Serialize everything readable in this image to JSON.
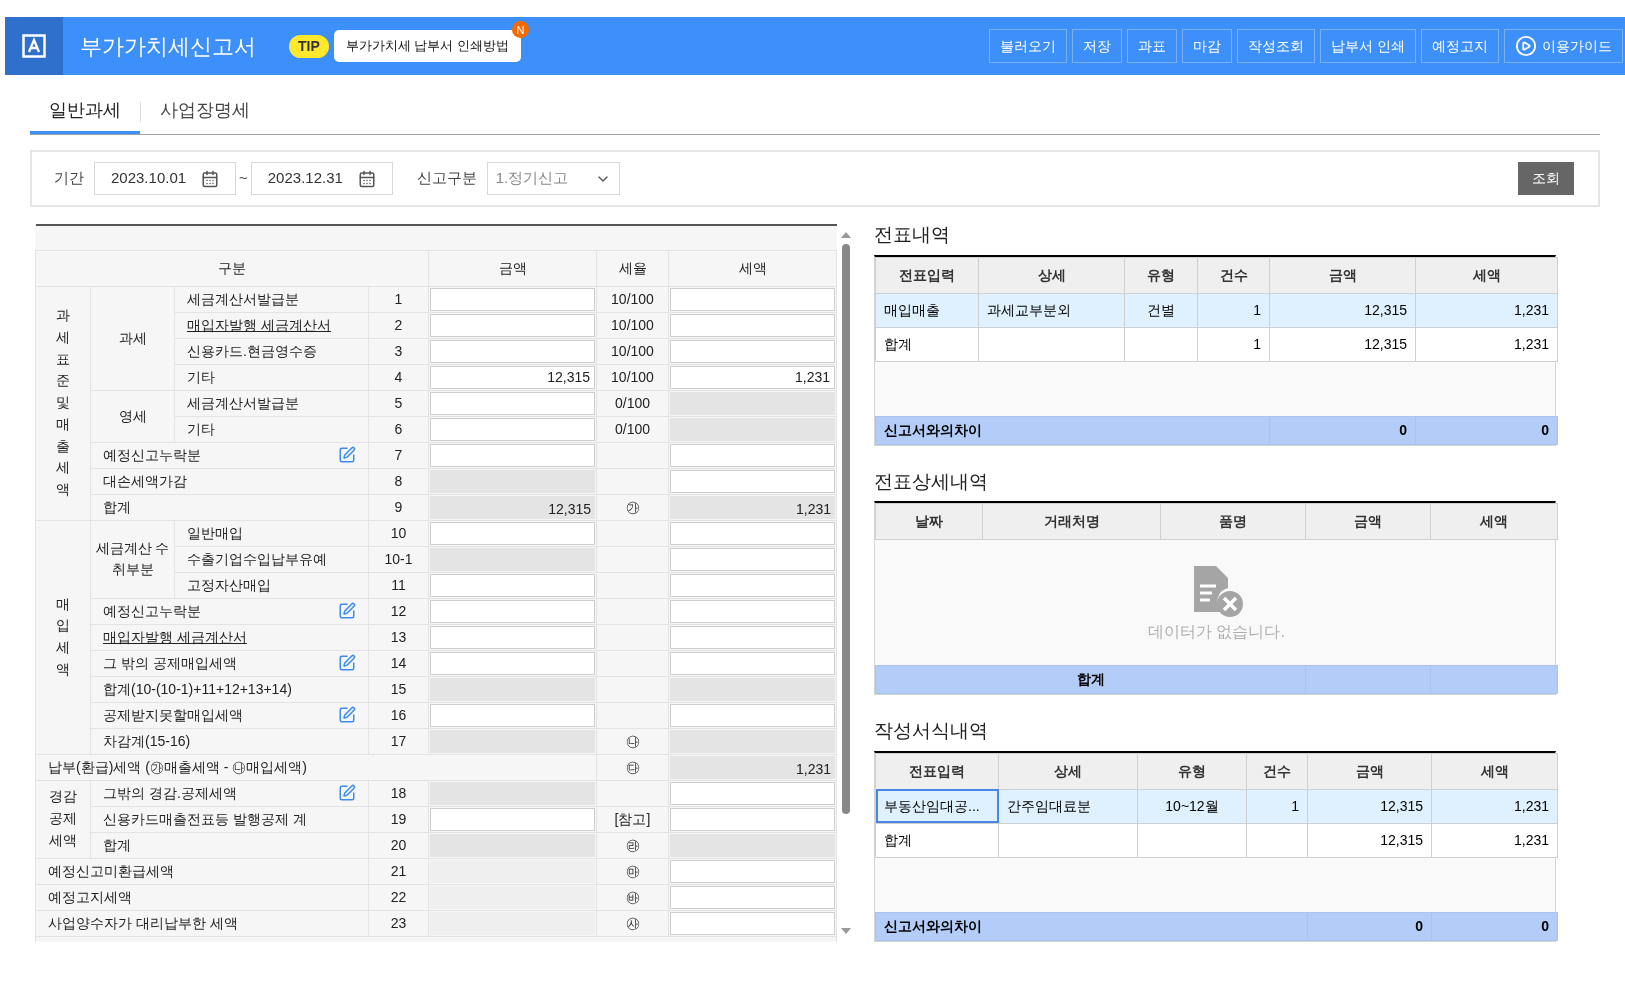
{
  "header": {
    "title": "부가가치세신고서",
    "tip_badge": "TIP",
    "tip_text": "부가가치세 납부서 인쇄방법",
    "tip_new": "N",
    "buttons": [
      {
        "label": "불러오기",
        "kind": "text"
      },
      {
        "label": "저장",
        "kind": "text"
      },
      {
        "label": "과표",
        "kind": "text"
      },
      {
        "label": "마감",
        "kind": "text"
      },
      {
        "label": "작성조회",
        "kind": "text"
      },
      {
        "label": "납부서 인쇄",
        "kind": "text"
      },
      {
        "label": "예정고지",
        "kind": "text"
      },
      {
        "label": "이용가이드",
        "kind": "guide"
      }
    ]
  },
  "tabs": [
    {
      "label": "일반과세",
      "selected": true
    },
    {
      "label": "사업장명세",
      "selected": false
    }
  ],
  "filter": {
    "period_label": "기간",
    "start": "2023.10.01",
    "separator": "~",
    "end": "2023.12.31",
    "type_label": "신고구분",
    "type_value": "1.정기신고",
    "search_button": "조회"
  },
  "form": {
    "columns": [
      "구분",
      "금액",
      "세율",
      "세액"
    ],
    "blocks": [
      {
        "kind": "section",
        "label": "과세표준및매출세액",
        "groups": [
          {
            "label": "과세",
            "rows": [
              {
                "label": "세금계산서발급분",
                "no": "1",
                "amount_editable": true,
                "rate": "10/100",
                "tax_editable": true,
                "link": false,
                "edit_icon": false
              },
              {
                "label": "매입자발행 세금계산서",
                "no": "2",
                "amount_editable": true,
                "rate": "10/100",
                "tax_editable": true,
                "link": true,
                "edit_icon": false
              },
              {
                "label": "신용카드.현금영수증",
                "no": "3",
                "amount_editable": true,
                "rate": "10/100",
                "tax_editable": true,
                "link": false,
                "edit_icon": false
              },
              {
                "label": "기타",
                "no": "4",
                "amount": "12,315",
                "amount_editable": true,
                "rate": "10/100",
                "tax": "1,231",
                "tax_editable": true,
                "link": false,
                "edit_icon": false
              }
            ]
          },
          {
            "label": "영세",
            "rows": [
              {
                "label": "세금계산서발급분",
                "no": "5",
                "amount_editable": true,
                "rate": "0/100",
                "tax_editable": false,
                "link": false,
                "edit_icon": false
              },
              {
                "label": "기타",
                "no": "6",
                "amount_editable": true,
                "rate": "0/100",
                "tax_editable": false,
                "link": false,
                "edit_icon": false
              }
            ]
          },
          {
            "rows": [
              {
                "label": "예정신고누락분",
                "no": "7",
                "amount_editable": true,
                "tax_editable": true,
                "link": false,
                "edit_icon": true
              },
              {
                "label": "대손세액가감",
                "no": "8",
                "amount_editable": false,
                "tax_editable": true,
                "link": false,
                "edit_icon": false
              },
              {
                "label": "합계",
                "no": "9",
                "amount": "12,315",
                "amount_editable": false,
                "rate": "㉮",
                "tax": "1,231",
                "tax_editable": false,
                "link": false,
                "edit_icon": false
              }
            ]
          }
        ]
      },
      {
        "kind": "section",
        "label": "매입세액",
        "groups": [
          {
            "label": "세금계산 수취부분",
            "rows": [
              {
                "label": "일반매입",
                "no": "10",
                "amount_editable": true,
                "tax_editable": true,
                "link": false,
                "edit_icon": false
              },
              {
                "label": "수출기업수입납부유예",
                "no": "10-1",
                "amount_editable": false,
                "tax_editable": true,
                "link": false,
                "edit_icon": false
              },
              {
                "label": "고정자산매입",
                "no": "11",
                "amount_editable": true,
                "tax_editable": true,
                "link": false,
                "edit_icon": false
              }
            ]
          },
          {
            "rows": [
              {
                "label": "예정신고누락분",
                "no": "12",
                "amount_editable": true,
                "tax_editable": true,
                "link": false,
                "edit_icon": true
              },
              {
                "label": "매입자발행 세금계산서",
                "no": "13",
                "amount_editable": true,
                "tax_editable": true,
                "link": true,
                "edit_icon": false
              },
              {
                "label": "그 밖의 공제매입세액",
                "no": "14",
                "amount_editable": true,
                "tax_editable": true,
                "link": false,
                "edit_icon": true
              },
              {
                "label": "합계(10-(10-1)+11+12+13+14)",
                "no": "15",
                "amount_editable": false,
                "tax_editable": false,
                "link": false,
                "edit_icon": false
              },
              {
                "label": "공제받지못할매입세액",
                "no": "16",
                "amount_editable": true,
                "tax_editable": true,
                "link": false,
                "edit_icon": true
              },
              {
                "label": "차감계(15-16)",
                "no": "17",
                "amount_editable": false,
                "rate": "㉯",
                "tax_editable": false,
                "link": false,
                "edit_icon": false
              }
            ]
          }
        ]
      },
      {
        "kind": "wide",
        "label": "납부(환급)세액 (㉮매출세액 - ㉯매입세액)",
        "rate": "㉰",
        "tax": "1,231",
        "tax_editable": false
      },
      {
        "kind": "block",
        "label": "경감 공제 세액",
        "groups": [
          {
            "rows": [
              {
                "label": "그밖의 경감.공제세액",
                "no": "18",
                "amount_editable": false,
                "tax_editable": true,
                "link": false,
                "edit_icon": true
              },
              {
                "label": "신용카드매출전표등 발행공제 계",
                "no": "19",
                "amount_editable": true,
                "rate": "[참고]",
                "tax_editable": true,
                "link": false,
                "edit_icon": false
              },
              {
                "label": "합계",
                "no": "20",
                "amount_editable": false,
                "rate": "㉱",
                "tax_editable": false,
                "link": false,
                "edit_icon": false
              }
            ]
          }
        ]
      },
      {
        "kind": "line",
        "label": "예정신고미환급세액",
        "no": "21",
        "rate": "㉲",
        "tax_editable": true
      },
      {
        "kind": "line",
        "label": "예정고지세액",
        "no": "22",
        "rate": "㉳",
        "tax_editable": true
      },
      {
        "kind": "line",
        "label": "사업양수자가 대리납부한 세액",
        "no": "23",
        "rate": "㉴",
        "tax_editable": true
      }
    ]
  },
  "voucher": {
    "title": "전표내역",
    "columns": [
      "전표입력",
      "상세",
      "유형",
      "건수",
      "금액",
      "세액"
    ],
    "rows": [
      {
        "selected": true,
        "focused": false,
        "cells": [
          "매입매출",
          "과세교부분외",
          "건별",
          "1",
          "12,315",
          "1,231"
        ]
      },
      {
        "selected": false,
        "focused": false,
        "cells": [
          "합계",
          null,
          null,
          "1",
          "12,315",
          "1,231"
        ]
      }
    ],
    "footer": {
      "label": "신고서와의차이",
      "amount": "0",
      "tax": "0"
    }
  },
  "voucher_detail": {
    "title": "전표상세내역",
    "columns": [
      "날짜",
      "거래처명",
      "품명",
      "금액",
      "세액"
    ],
    "empty_text": "데이터가 없습니다.",
    "footer": {
      "label": "합계"
    }
  },
  "forms_written": {
    "title": "작성서식내역",
    "columns": [
      "전표입력",
      "상세",
      "유형",
      "건수",
      "금액",
      "세액"
    ],
    "rows": [
      {
        "selected": true,
        "focused": true,
        "cells": [
          "부동산임대공...",
          "간주임대료분",
          "10~12월",
          "1",
          "12,315",
          "1,231"
        ]
      },
      {
        "selected": false,
        "focused": false,
        "cells": [
          "합계",
          null,
          null,
          null,
          "12,315",
          "1,231"
        ]
      }
    ],
    "footer": {
      "label": "신고서와의차이",
      "amount": "0",
      "tax": "0"
    }
  }
}
